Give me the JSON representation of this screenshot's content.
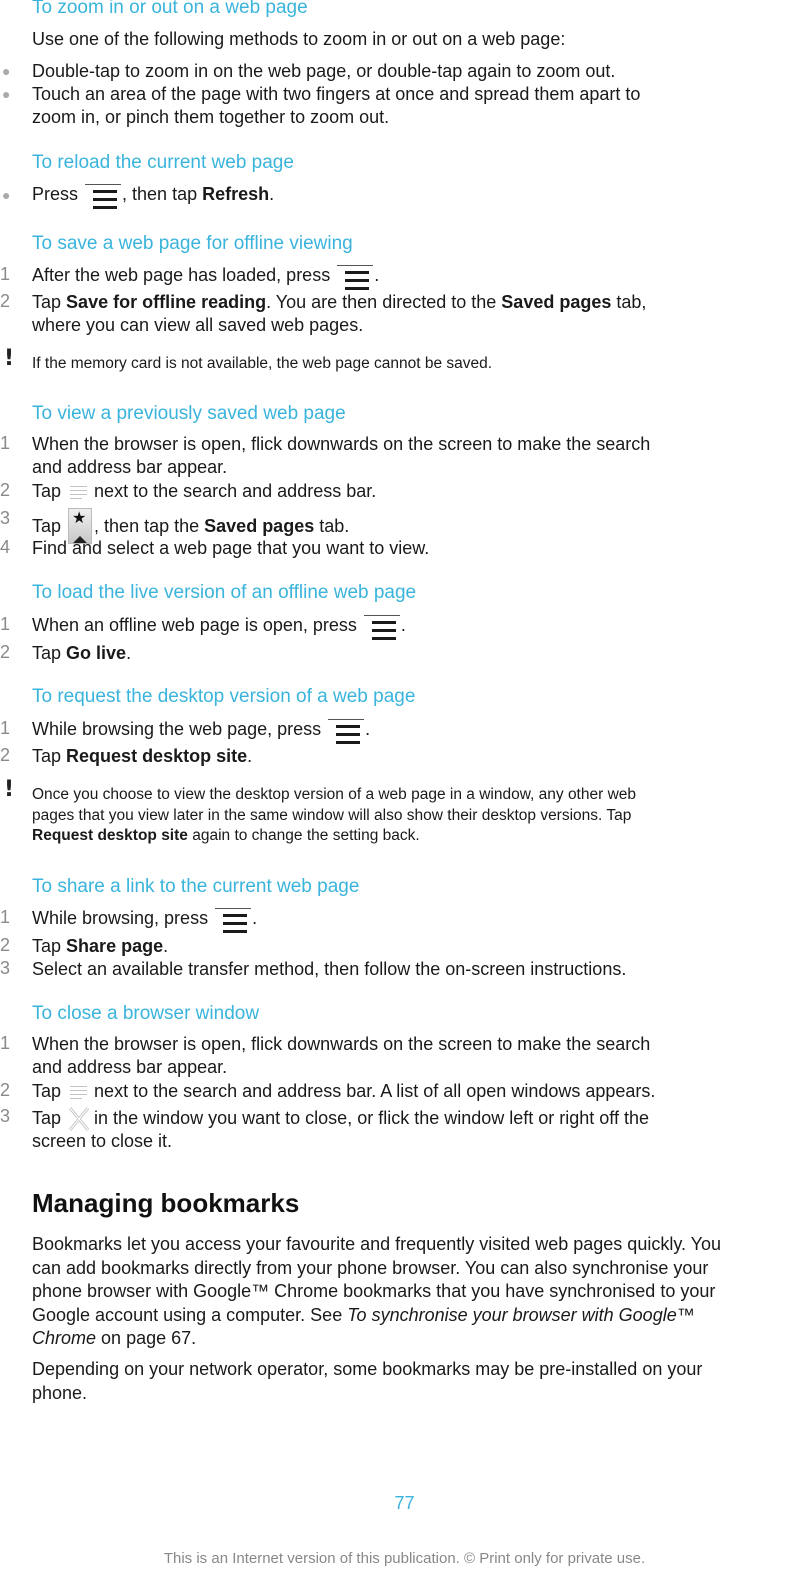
{
  "sections": {
    "zoom": {
      "heading": "To zoom in or out on a web page",
      "intro": "Use one of the following methods to zoom in or out on a web page:",
      "bullets": [
        "Double-tap to zoom in on the web page, or double-tap again to zoom out.",
        "Touch an area of the page with two fingers at once and spread them apart to",
        "zoom in, or pinch them together to zoom out."
      ]
    },
    "reload": {
      "heading": "To reload the current web page",
      "step_pre": "Press",
      "step_mid": ", then tap",
      "step_bold": "Refresh",
      "step_post": "."
    },
    "save": {
      "heading": "To save a web page for offline viewing",
      "steps": [
        {
          "num": "1",
          "pre": "After the web page has loaded, press",
          "post": "."
        },
        {
          "num": "2",
          "pre": "Tap",
          "bold1": "Save for offline reading",
          "mid": ". You are then directed to the",
          "bold2": "Saved pages",
          "post": "tab,",
          "line2": "where you can view all saved web pages."
        }
      ],
      "note": "If the memory card is not available, the web page cannot be saved."
    },
    "view_saved": {
      "heading": "To view a previously saved web page",
      "steps": [
        {
          "num": "1",
          "line1": "When the browser is open, flick downwards on the screen to make the search",
          "line2": "and address bar appear."
        },
        {
          "num": "2",
          "pre": "Tap",
          "post": "next to the search and address bar."
        },
        {
          "num": "3",
          "pre": "Tap",
          "mid": ", then tap the",
          "bold": "Saved pages",
          "post": "tab."
        },
        {
          "num": "4",
          "text": "Find and select a web page that you want to view."
        }
      ]
    },
    "live": {
      "heading": "To load the live version of an offline web page",
      "steps": [
        {
          "num": "1",
          "pre": "When an offline web page is open, press",
          "post": "."
        },
        {
          "num": "2",
          "pre": "Tap",
          "bold": "Go live",
          "post": "."
        }
      ]
    },
    "desktop": {
      "heading": "To request the desktop version of a web page",
      "steps": [
        {
          "num": "1",
          "pre": "While browsing the web page, press",
          "post": "."
        },
        {
          "num": "2",
          "pre": "Tap",
          "bold": "Request desktop site",
          "post": "."
        }
      ],
      "note_line1": "Once you choose to view the desktop version of a web page in a window, any other web",
      "note_line2": "pages that you view later in the same window will also show their desktop versions. Tap",
      "note_bold": "Request desktop site",
      "note_post": "again to change the setting back."
    },
    "share": {
      "heading": "To share a link to the current web page",
      "steps": [
        {
          "num": "1",
          "pre": "While browsing, press",
          "post": "."
        },
        {
          "num": "2",
          "pre": "Tap",
          "bold": "Share page",
          "post": "."
        },
        {
          "num": "3",
          "text": "Select an available transfer method, then follow the on-screen instructions."
        }
      ]
    },
    "close": {
      "heading": "To close a browser window",
      "steps": [
        {
          "num": "1",
          "line1": "When the browser is open, flick downwards on the screen to make the search",
          "line2": "and address bar appear."
        },
        {
          "num": "2",
          "pre": "Tap",
          "post": "next to the search and address bar. A list of all open windows appears."
        },
        {
          "num": "3",
          "pre": "Tap",
          "post": "in the window you want to close, or flick the window left or right off the",
          "line2": "screen to close it."
        }
      ]
    }
  },
  "bookmarks": {
    "heading": "Managing bookmarks",
    "p1_lines": [
      "Bookmarks let you access your favourite and frequently visited web pages quickly. You",
      "can add bookmarks directly from your phone browser. You can also synchronise your",
      "phone browser with Google™ Chrome bookmarks that you have synchronised to your"
    ],
    "p1_line4_pre": "Google account using a computer. See",
    "p1_link_a": "To synchronise your browser with Google™",
    "p1_link_b": "Chrome",
    "p1_post": "on page 67.",
    "p2_line1": "Depending on your network operator, some bookmarks may be pre-installed on your",
    "p2_line2": "phone."
  },
  "page_number": "77",
  "footer": "This is an Internet version of this publication. © Print only for private use."
}
